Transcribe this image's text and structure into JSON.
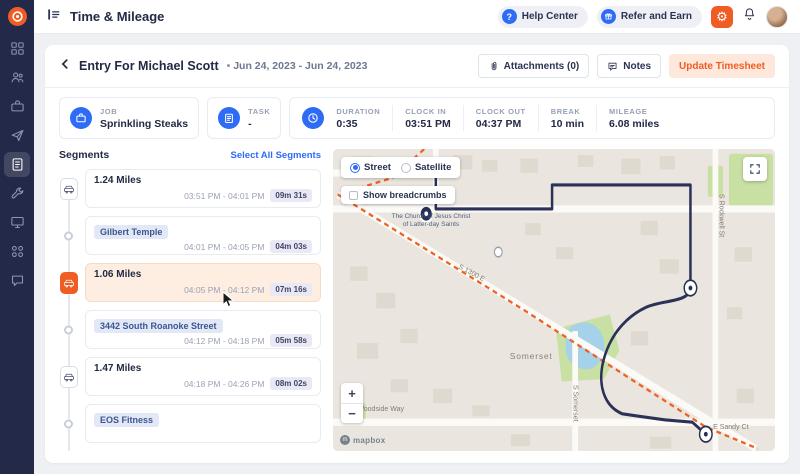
{
  "theme": {
    "accent_orange": "#f05d24",
    "link_blue": "#2e6bf6",
    "route_navy": "#2b3157",
    "trail_orange": "#f06024",
    "sidebar_navy": "#232a49"
  },
  "topbar": {
    "title": "Time & Mileage",
    "help_center": "Help Center",
    "refer_earn": "Refer and Earn"
  },
  "entry": {
    "title": "Entry For Michael Scott",
    "date_range": "Jun 24, 2023 - Jun 24, 2023",
    "attachments_label": "Attachments (0)",
    "notes_label": "Notes",
    "update_label": "Update Timesheet"
  },
  "summary": {
    "job": {
      "label": "JOB",
      "value": "Sprinkling Steaks"
    },
    "task": {
      "label": "TASK",
      "value": "-"
    },
    "stats": [
      {
        "label": "DURATION",
        "value": "0:35"
      },
      {
        "label": "CLOCK IN",
        "value": "03:51 PM"
      },
      {
        "label": "CLOCK OUT",
        "value": "04:37 PM"
      },
      {
        "label": "BREAK",
        "value": "10 min"
      },
      {
        "label": "MILEAGE",
        "value": "6.08 miles"
      }
    ]
  },
  "segments": {
    "title": "Segments",
    "select_all": "Select All Segments",
    "items": [
      {
        "kind": "drive",
        "title": "1.24 Miles",
        "time": "03:51 PM - 04:01 PM",
        "duration": "09m 31s"
      },
      {
        "kind": "stop",
        "title": "Gilbert Temple",
        "time": "04:01 PM - 04:05 PM",
        "duration": "04m 03s"
      },
      {
        "kind": "drive",
        "title": "1.06 Miles",
        "time": "04:05 PM - 04:12 PM",
        "duration": "07m 16s",
        "highlighted": true
      },
      {
        "kind": "stop",
        "title": "3442 South Roanoke Street",
        "time": "04:12 PM - 04:18 PM",
        "duration": "05m 58s"
      },
      {
        "kind": "drive",
        "title": "1.47 Miles",
        "time": "04:18 PM - 04:26 PM",
        "duration": "08m 02s"
      },
      {
        "kind": "stop",
        "title": "EOS Fitness"
      }
    ]
  },
  "map": {
    "layer_street": "Street",
    "layer_satellite": "Satellite",
    "breadcrumbs_label": "Show breadcrumbs",
    "zoom_in": "+",
    "zoom_out": "−",
    "logo": "mapbox",
    "labels": {
      "church": "The Church of Jesus Christ of Latter-day Saints",
      "somerset": "Somerset",
      "woodside": "E Woodside Way",
      "sandy": "E Sandy Ct",
      "rockwell": "S Rockwell St",
      "street_diag": "S 1300 E",
      "street_bottom": "S Somerset"
    }
  }
}
